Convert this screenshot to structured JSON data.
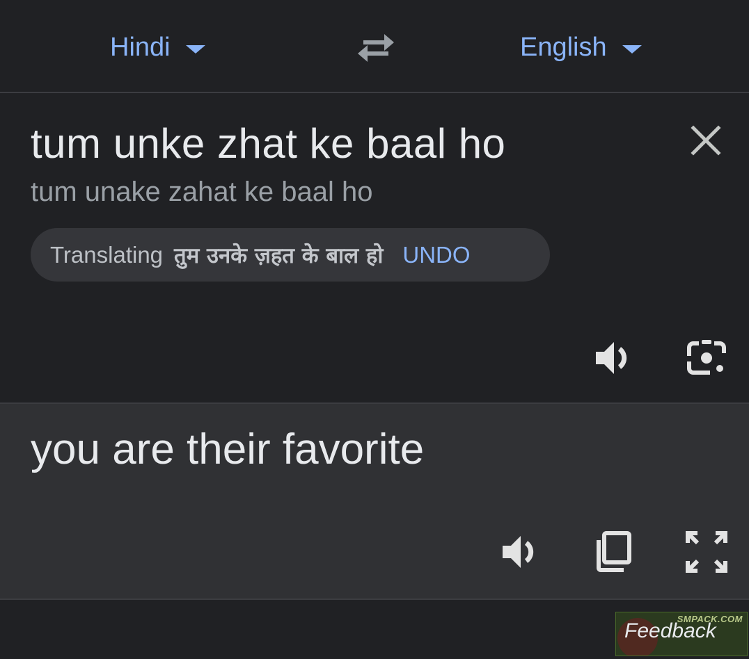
{
  "language_bar": {
    "source_language": "Hindi",
    "target_language": "English",
    "swap_icon": "swap-arrows-icon"
  },
  "source": {
    "input_text": "tum unke zhat ke baal ho",
    "transliteration": "tum unake zahat ke baal ho",
    "suggestion": {
      "label": "Translating",
      "hindi_text": "तुम उनके ज़हत के बाल हो",
      "undo_label": "UNDO"
    },
    "icons": [
      "close-icon",
      "speaker-icon",
      "camera-lens-icon"
    ]
  },
  "result": {
    "translation": "you are their favorite",
    "icons": [
      "speaker-icon",
      "copy-icon",
      "fullscreen-icon"
    ]
  },
  "watermark": {
    "label": "Feedback",
    "site": "SMPACK.COM"
  },
  "colors": {
    "background": "#202124",
    "result_background": "#303134",
    "accent": "#8ab4f8",
    "chip_background": "#35363a"
  }
}
